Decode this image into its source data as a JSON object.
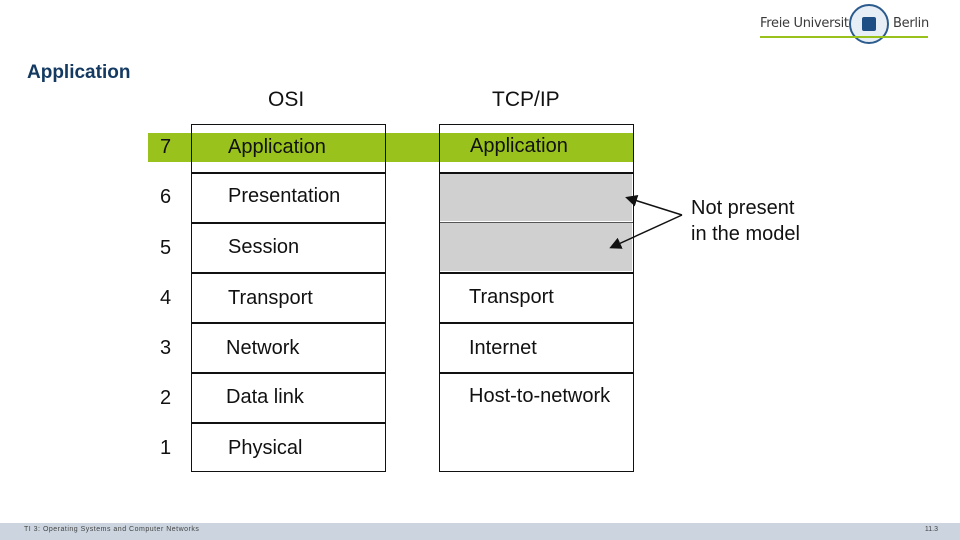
{
  "header": {
    "title": "Application",
    "logo": {
      "left_text": "Freie Universität",
      "right_text": "Berlin",
      "seal_icon": "university-seal-icon"
    }
  },
  "diagram": {
    "osi_title": "OSI",
    "tcpip_title": "TCP/IP",
    "osi_layers": [
      {
        "number": "7",
        "name": "Application"
      },
      {
        "number": "6",
        "name": "Presentation"
      },
      {
        "number": "5",
        "name": "Session"
      },
      {
        "number": "4",
        "name": "Transport"
      },
      {
        "number": "3",
        "name": "Network"
      },
      {
        "number": "2",
        "name": "Data link"
      },
      {
        "number": "1",
        "name": "Physical"
      }
    ],
    "tcpip_layers": [
      "Application",
      "Transport",
      "Internet",
      "Host-to-network"
    ],
    "note_line1": "Not present",
    "note_line2": "in the model",
    "highlight_color": "#99c31c",
    "absent_color": "#d0d0d0"
  },
  "footer": {
    "course": "TI 3: Operating Systems and Computer Networks",
    "page": "11.3"
  }
}
